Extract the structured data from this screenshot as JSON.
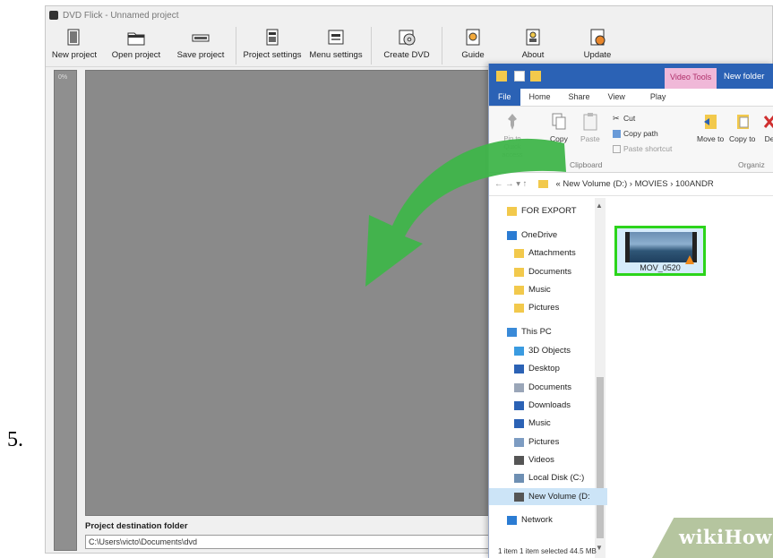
{
  "step_number": "5.",
  "dvd_flick": {
    "title": "DVD Flick - Unnamed project",
    "toolbar": [
      {
        "label": "New project",
        "icon": "new-project-icon"
      },
      {
        "label": "Open project",
        "icon": "open-folder-icon"
      },
      {
        "label": "Save project",
        "icon": "save-icon"
      },
      {
        "label": "Project settings",
        "icon": "project-settings-icon"
      },
      {
        "label": "Menu settings",
        "icon": "menu-settings-icon"
      },
      {
        "label": "Create DVD",
        "icon": "create-dvd-icon"
      },
      {
        "label": "Guide",
        "icon": "guide-icon"
      },
      {
        "label": "About",
        "icon": "about-icon"
      },
      {
        "label": "Update",
        "icon": "update-icon"
      }
    ],
    "sidebar_percent": "0%",
    "destination_label": "Project destination folder",
    "destination_value": "C:\\Users\\victo\\Documents\\dvd"
  },
  "explorer": {
    "contextual_tab": "Video Tools",
    "window_title": "New folder",
    "tabs": [
      "File",
      "Home",
      "Share",
      "View",
      "Play"
    ],
    "ribbon": {
      "pin_label": "Pin to Quick access",
      "copy_label": "Copy",
      "paste_label": "Paste",
      "cut_label": "Cut",
      "copy_path_label": "Copy path",
      "paste_shortcut_label": "Paste shortcut",
      "move_to_label": "Move to",
      "copy_to_label": "Copy to",
      "delete_label": "De",
      "clipboard_group": "Clipboard",
      "organize_group": "Organiz"
    },
    "address": {
      "nav": "← → ▾ ↑",
      "crumbs": "« New Volume (D:) › MOVIES › 100ANDR"
    },
    "nav_items": [
      {
        "label": "FOR EXPORT",
        "icon": "folder-icon"
      },
      {
        "label": "OneDrive",
        "icon": "cloud-icon"
      },
      {
        "label": "Attachments",
        "icon": "folder-icon"
      },
      {
        "label": "Documents",
        "icon": "folder-icon"
      },
      {
        "label": "Music",
        "icon": "folder-icon"
      },
      {
        "label": "Pictures",
        "icon": "folder-icon"
      },
      {
        "label": "This PC",
        "icon": "computer-icon"
      },
      {
        "label": "3D Objects",
        "icon": "cube-icon"
      },
      {
        "label": "Desktop",
        "icon": "desktop-icon"
      },
      {
        "label": "Documents",
        "icon": "document-icon"
      },
      {
        "label": "Downloads",
        "icon": "download-icon"
      },
      {
        "label": "Music",
        "icon": "music-icon"
      },
      {
        "label": "Pictures",
        "icon": "picture-icon"
      },
      {
        "label": "Videos",
        "icon": "video-icon"
      },
      {
        "label": "Local Disk (C:)",
        "icon": "disk-icon"
      },
      {
        "label": "New Volume (D:",
        "icon": "drive-icon"
      },
      {
        "label": "Network",
        "icon": "network-icon"
      }
    ],
    "file": {
      "name": "MOV_0520",
      "icon": "video-file-icon"
    },
    "status": "1 item    1 item selected  44.5 MB"
  },
  "watermark": "wikiHow",
  "colors": {
    "accent_green": "#2cd41b",
    "arrow_green": "#3fb54a",
    "ribbon_blue": "#2b62b5"
  }
}
